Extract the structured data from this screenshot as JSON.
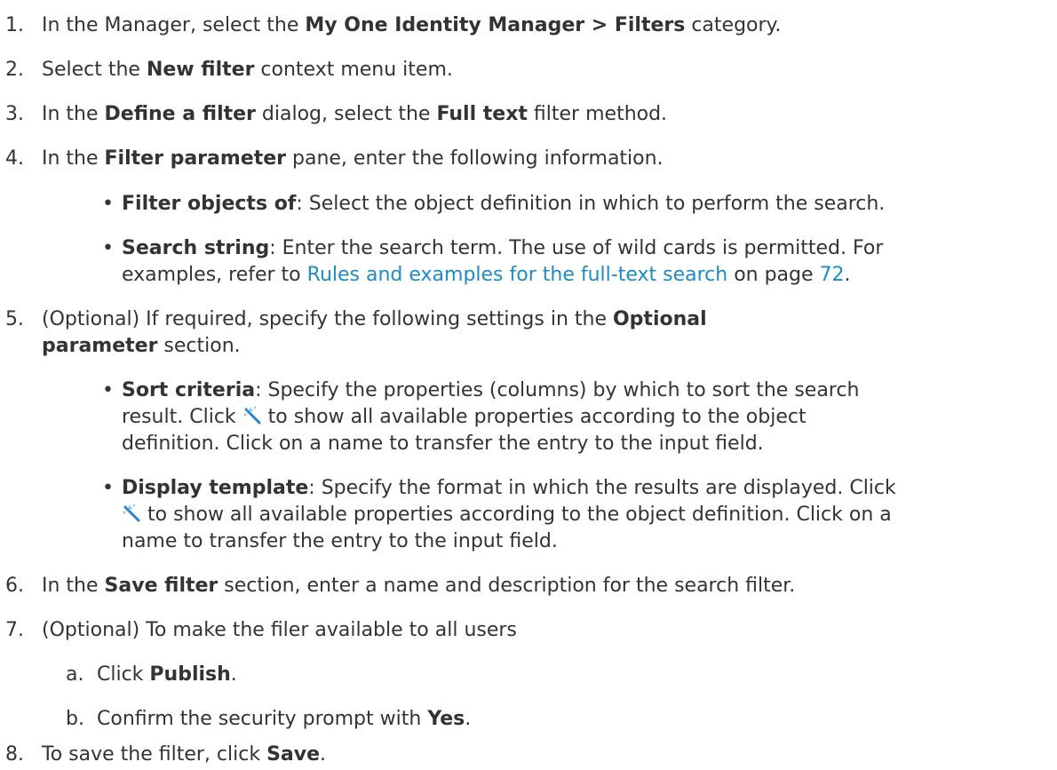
{
  "steps": [
    {
      "num": "1.",
      "parts": [
        "In the Manager, select the ",
        "My One Identity Manager > Filters",
        " category."
      ]
    },
    {
      "num": "2.",
      "parts": [
        "Select the ",
        "New filter",
        " context menu item."
      ]
    },
    {
      "num": "3.",
      "parts": [
        "In the ",
        "Define a filter",
        " dialog, select the ",
        "Full text",
        " filter method."
      ]
    },
    {
      "num": "4.",
      "parts": [
        "In the ",
        "Filter parameter",
        " pane, enter the following information."
      ]
    },
    {
      "num": "5.",
      "parts": [
        "(Optional) If required, specify the following settings in the ",
        "Optional",
        "parameter",
        " section."
      ]
    },
    {
      "num": "6.",
      "parts": [
        "In the ",
        "Save filter",
        " section, enter a name and description for the search filter."
      ]
    },
    {
      "num": "7.",
      "parts": [
        "(Optional) To make the filer available to all users"
      ]
    },
    {
      "num": "8.",
      "parts": [
        "To save the filter, click ",
        "Save",
        "."
      ]
    }
  ],
  "bullets": {
    "filter_objects": {
      "label": "Filter objects of",
      "text": ": Select the object definition in which to perform the search."
    },
    "search_string": {
      "label": "Search string",
      "text1": ": Enter the search term. The use of wild cards is permitted. For",
      "text2": "examples, refer to ",
      "link": "Rules and examples for the full-text search",
      "text3": " on page ",
      "page_link": "72",
      "text4": "."
    },
    "sort_criteria": {
      "label": "Sort criteria",
      "text1": ": Specify the properties (columns) by which to sort the search",
      "text2a": "result. Click ",
      "text2b": " to show all available properties according to the object",
      "text3": "definition. Click on a name to transfer the entry to the input field."
    },
    "display_template": {
      "label": "Display template",
      "text1": ": Specify the format in which the results are displayed. Click",
      "text2": " to show all available properties according to the object definition. Click on a",
      "text3": "name to transfer the entry to the input field."
    }
  },
  "substeps": [
    {
      "letter": "a.",
      "parts": [
        "Click ",
        "Publish",
        "."
      ]
    },
    {
      "letter": "b.",
      "parts": [
        "Confirm the security prompt with ",
        "Yes",
        "."
      ]
    }
  ],
  "bullet_char": "•",
  "icons": {
    "wand": "magic-wand-icon"
  },
  "colors": {
    "text": "#333333",
    "link": "#1e8bc3"
  }
}
